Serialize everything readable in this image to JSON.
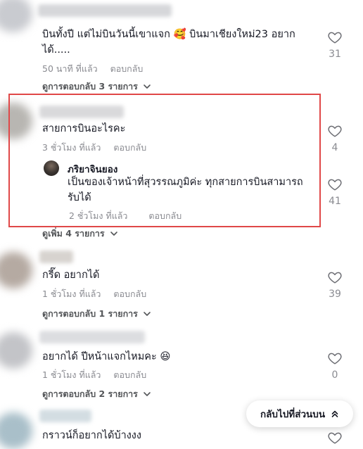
{
  "comments": [
    {
      "text_line1": "บินทั้งปี แต่ไม่บินวันนี้เขาแจก 🥰 บินมาเชียงใหม่23 อยาก",
      "text_line2": "ได้.....",
      "time": "50 นาที ที่แล้ว",
      "reply_label": "ตอบกลับ",
      "likes": "31",
      "view_replies": "ดูการตอบกลับ 3 รายการ"
    },
    {
      "text_line1": "สายการบินอะไรคะ",
      "time": "3 ชั่วโมง ที่แล้ว",
      "reply_label": "ตอบกลับ",
      "likes": "4",
      "reply": {
        "author": "ภริยาจินยอง",
        "text_line1": "เป็นของเจ้าหน้าที่สุวรรณภูมิค่ะ ทุกสายการบินสามารถ",
        "text_line2": "รับได้",
        "time": "2 ชั่วโมง ที่แล้ว",
        "reply_label": "ตอบกลับ",
        "likes": "41"
      },
      "view_more": "ดูเพิ่ม 4 รายการ"
    },
    {
      "text_line1": "กรี๊ด อยากได้",
      "time": "1 ชั่วโมง ที่แล้ว",
      "reply_label": "ตอบกลับ",
      "likes": "39",
      "view_replies": "ดูการตอบกลับ 1 รายการ"
    },
    {
      "text_line1": "อยากได้ ปีหน้าแจกไหมคะ 😆",
      "time": "1 ชั่วโมง ที่แล้ว",
      "reply_label": "ตอบกลับ",
      "likes": "0",
      "view_replies": "ดูการตอบกลับ 2 รายการ"
    },
    {
      "text_line1": "กราวน์ก็อยากได้บ้างงง"
    }
  ],
  "back_to_top": "กลับไปที่ส่วนบน",
  "colors": {
    "highlight": "#e04848",
    "muted": "#8a8b91",
    "text": "#161823"
  }
}
